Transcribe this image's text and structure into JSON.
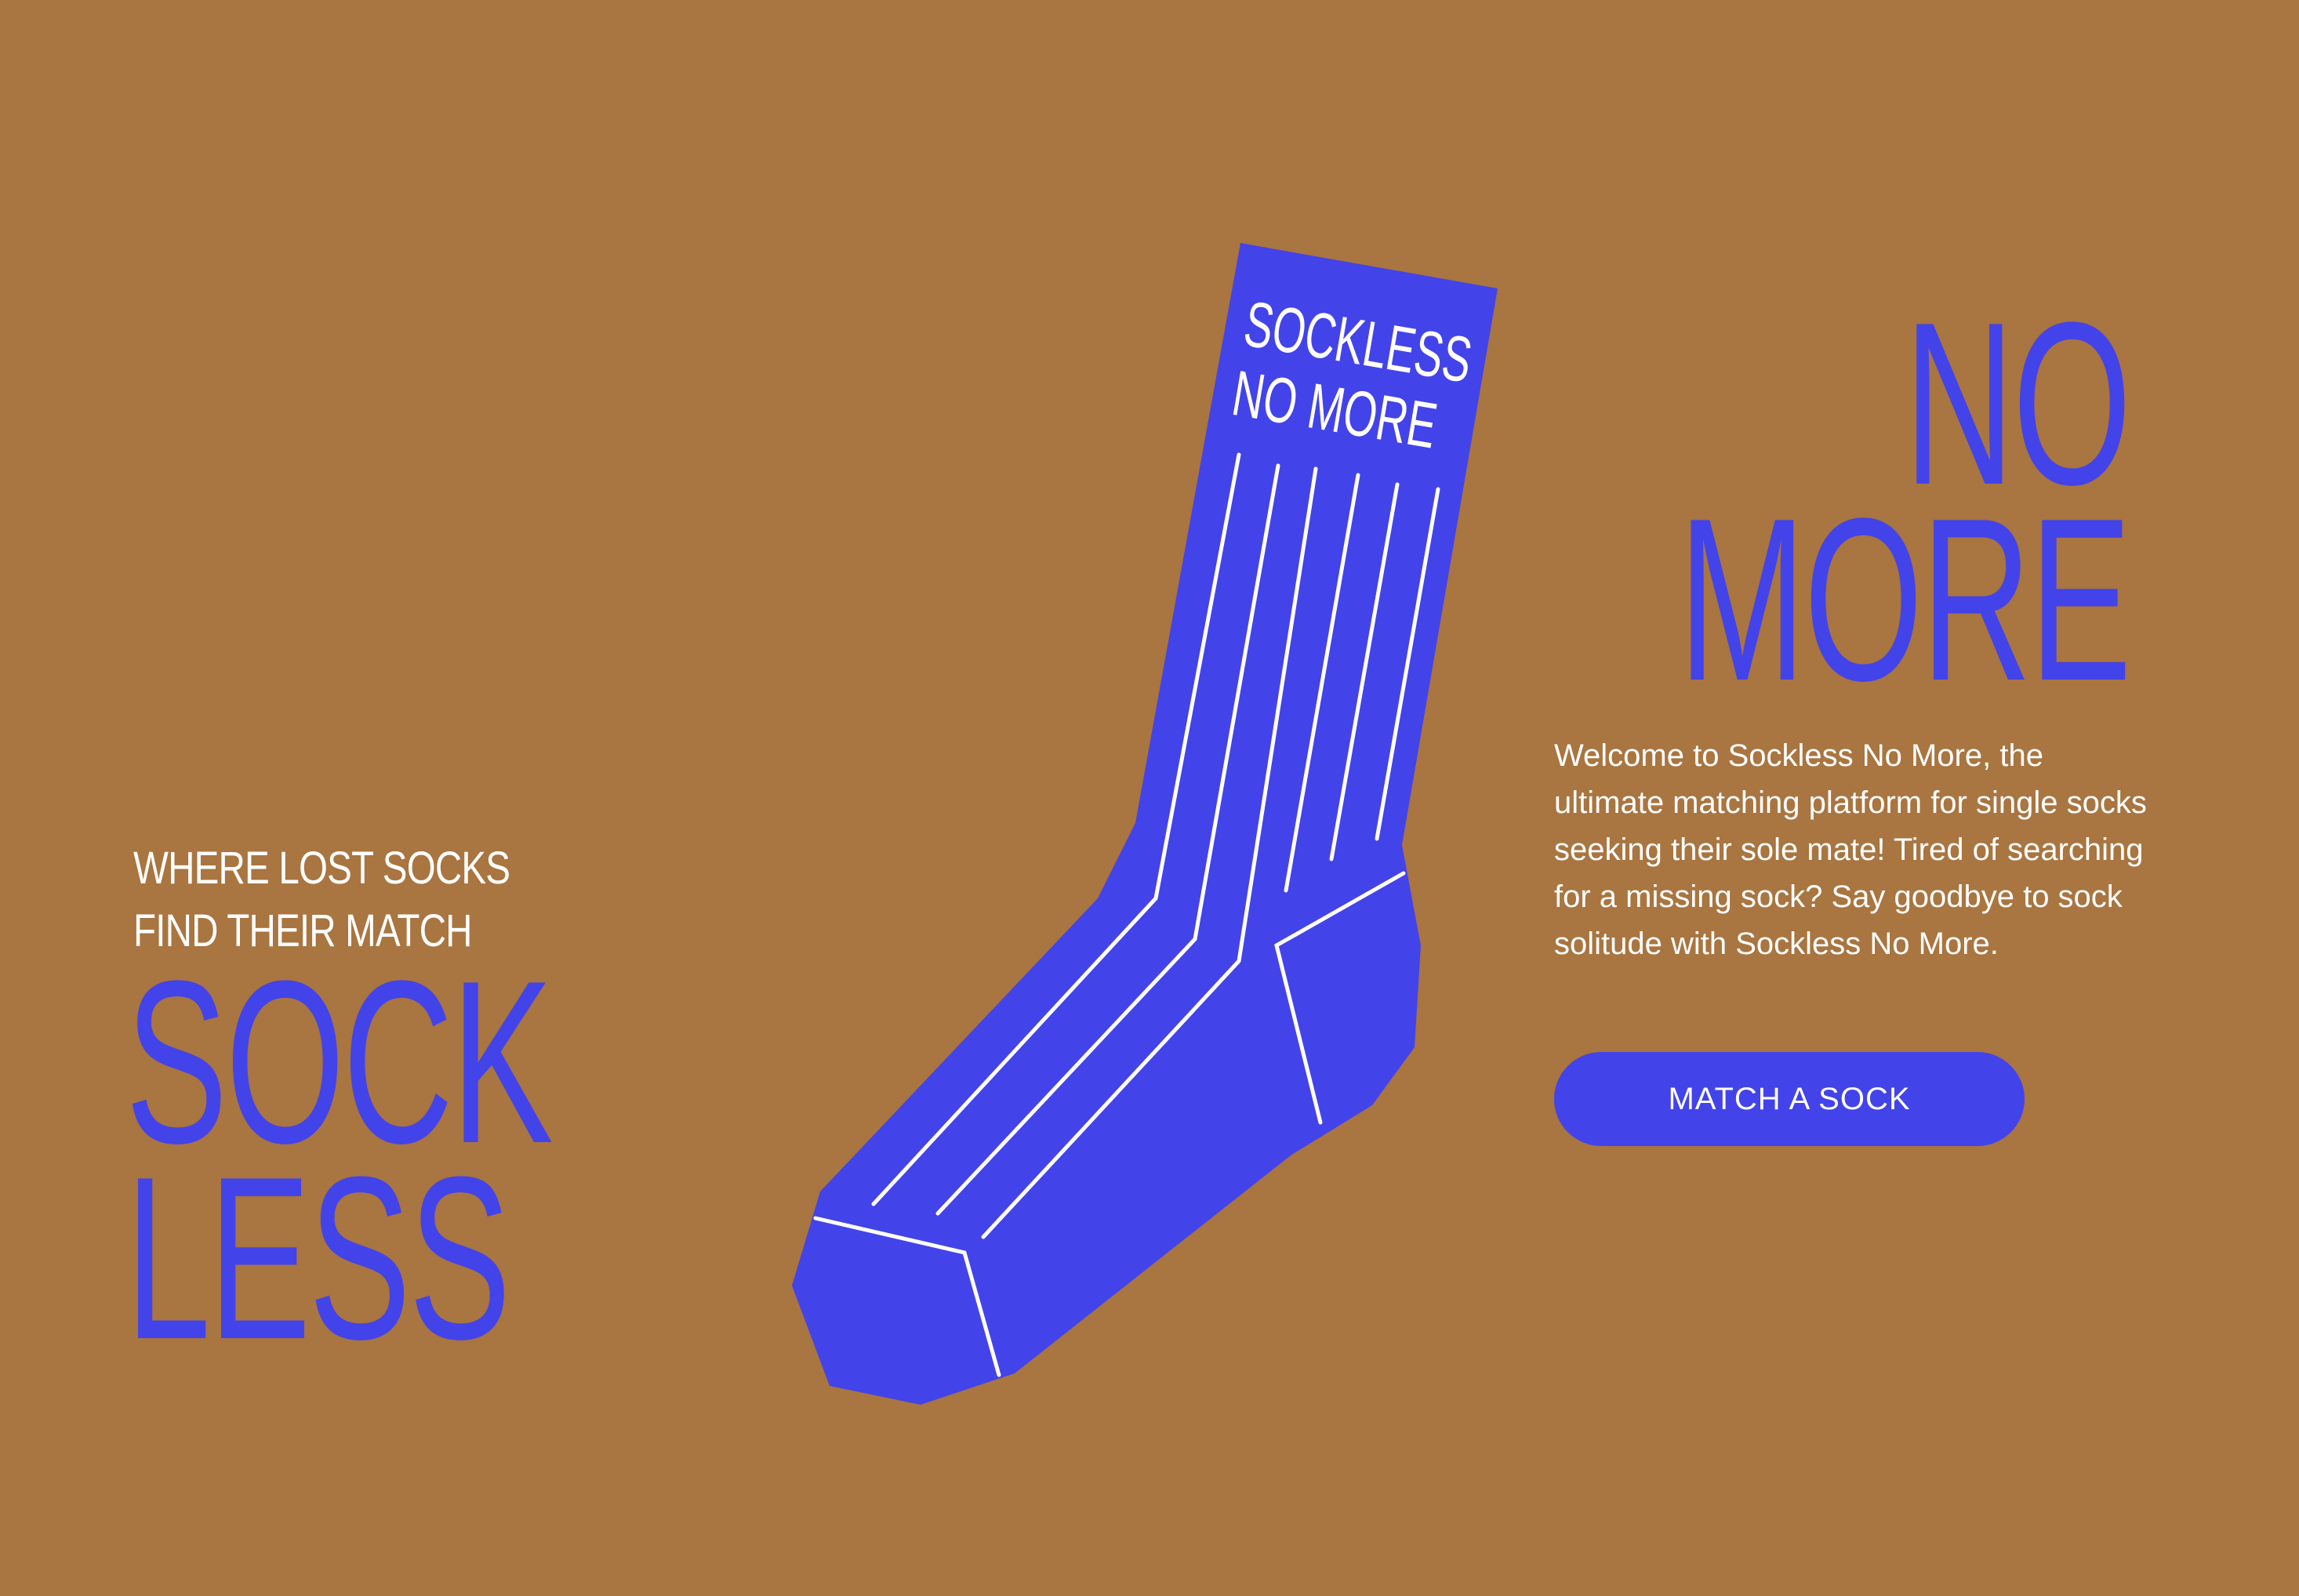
{
  "tagline": {
    "line1": "WHERE LOST SOCKS",
    "line2": "FIND THEIR MATCH"
  },
  "hero_left": {
    "line1": "SOCK",
    "line2": "LESS"
  },
  "hero_right": {
    "line1": "NO",
    "line2": "MORE"
  },
  "sock_graphic": {
    "label_line1": "SOCKLESS",
    "label_line2": "NO MORE",
    "icon": "sock-illustration"
  },
  "description": "Welcome to Sockless No More, the ultimate matching platform for single socks seeking their sole mate! Tired of searching for a missing sock? Say goodbye to sock solitude with Sockless No More.",
  "cta": {
    "label": "MATCH A SOCK"
  },
  "colors": {
    "background": "#A97540",
    "accent": "#4343EA",
    "text": "#FFFFFF"
  }
}
